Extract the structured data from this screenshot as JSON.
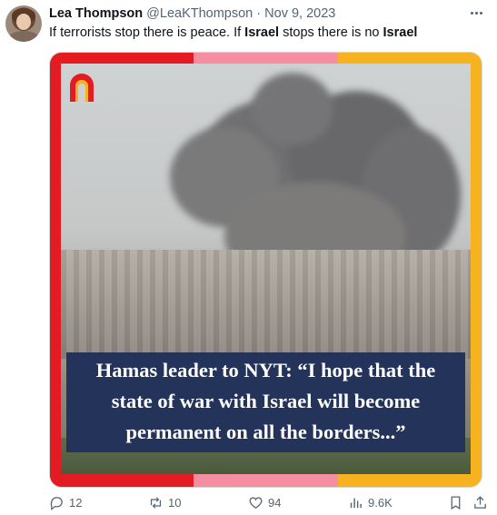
{
  "author": {
    "name": "Lea Thompson",
    "handle": "@LeaKThompson",
    "separator": "·",
    "date": "Nov 9, 2023"
  },
  "tweet": {
    "text_part1": "If terrorists stop there is peace. If ",
    "text_bold1": "Israel",
    "text_part2": " stops there is no ",
    "text_bold2": "Israel"
  },
  "media": {
    "caption_lines": [
      "Hamas leader to NYT: “I hope that the",
      "state of war with Israel will become",
      "permanent on all the borders...”"
    ],
    "frame_colors": {
      "red": "#e51b24",
      "pink": "#f58ea0",
      "yellow": "#f7b21f",
      "caption_bg": "#24335a"
    },
    "logo_icon": "n-arch-logo-icon"
  },
  "actions": {
    "replies": "12",
    "reposts": "10",
    "likes": "94",
    "views": "9.6K"
  },
  "colors": {
    "text": "#0f1419",
    "secondary": "#536471"
  }
}
